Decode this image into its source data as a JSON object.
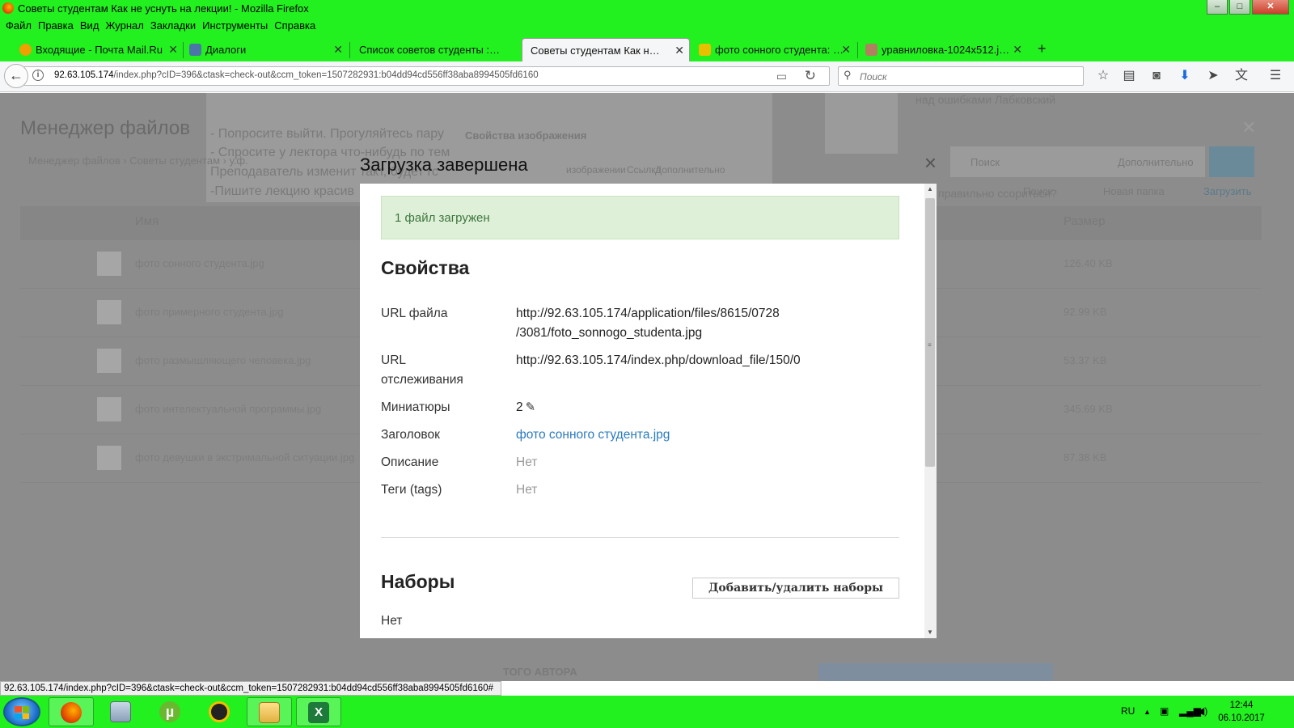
{
  "window": {
    "title": "Советы студентам Как не уснуть на лекции! - Mozilla Firefox",
    "controls": [
      "–",
      "□",
      "✕"
    ]
  },
  "menu": [
    "Файл",
    "Правка",
    "Вид",
    "Журнал",
    "Закладки",
    "Инструменты",
    "Справка"
  ],
  "tabs": [
    {
      "label": "Входящие - Почта Mail.Ru",
      "icon_color": "#f0a000"
    },
    {
      "label": "Диалоги",
      "icon_color": "#4a76a8"
    },
    {
      "label": "Список советов студенты :: со...",
      "icon_color": ""
    },
    {
      "label": "Советы студентам Как не усн...",
      "icon_color": ""
    },
    {
      "label": "фото сонного студента: 1...",
      "icon_color": "#e8c000"
    },
    {
      "label": "уравниловка-1024x512.jpg...",
      "icon_color": "#b08060"
    }
  ],
  "tab_close": "✕",
  "new_tab": "+",
  "address": {
    "host": "92.63.105.174",
    "path": "/index.php?cID=396&ctask=check-out&ccm_token=1507282931:b04dd94cd556ff38aba8994505fd6160"
  },
  "search": {
    "placeholder": "Поиск"
  },
  "toolbar_icons": [
    "star-icon",
    "reading-list-icon",
    "pocket-icon",
    "download-icon",
    "send-icon",
    "translate-icon",
    "menu-icon"
  ],
  "background": {
    "heading": "Менеджер файлов",
    "breadcrumb": "Менеджер файлов  ›  Советы студентам  ›  у.ф.",
    "article_lines": [
      "- Попросите выйти. Прогуляйтесь пару",
      "- Спросите у лектора что-нибудь по тем",
      "Преподаватель изменит такт, будет гс",
      "-Пишите лекцию красив"
    ],
    "inner_dialog_title": "Свойства изображения",
    "inner_tabs": [
      "изображении",
      "Ссылка",
      "Дополнительно"
    ],
    "right_text": "над ошибками Лабковский",
    "right_text_2": "правильно ссориться?",
    "search_ph": "Поиск",
    "search_extra": "Дополнительно",
    "actions": [
      "Поиск",
      "Новая папка",
      "Загрузить"
    ],
    "col_name": "Имя",
    "col_size": "Размер",
    "files": [
      {
        "name": "фото сонного студента.jpg",
        "size": "126.40 KB"
      },
      {
        "name": "фото примерного студента.jpg",
        "size": "92.99 KB"
      },
      {
        "name": "фото размышляющего человека.jpg",
        "size": "53.37 KB"
      },
      {
        "name": "фото интелектуальной программы.jpg",
        "size": "345.69 KB"
      },
      {
        "name": "фото девушки в экстримальной ситуации.jpg",
        "size": "87.38 KB"
      }
    ],
    "bottom_text": "ТОГО АВТОРА"
  },
  "modal": {
    "title": "Загрузка завершена",
    "close": "×",
    "alert": "1 файл загружен",
    "properties_heading": "Свойства",
    "props": {
      "url_label": "URL файла",
      "url_value_1": "http://92.63.105.174/application/files/8615/0728",
      "url_value_2": "/3081/foto_sonnogo_studenta.jpg",
      "track_label_1": "URL",
      "track_label_2": "отслеживания",
      "track_value": "http://92.63.105.174/index.php/download_file/150/0",
      "thumbs_label": "Миниатюры",
      "thumbs_value": "2",
      "title_label": "Заголовок",
      "title_value": "фото сонного студента.jpg",
      "desc_label": "Описание",
      "desc_value": "Нет",
      "tags_label": "Теги (tags)",
      "tags_value": "Нет"
    },
    "sets_heading": "Наборы",
    "sets_button": "Добавить/удалить наборы",
    "sets_value": "Нет"
  },
  "status_url": "92.63.105.174/index.php?cID=396&ctask=check-out&ccm_token=1507282931:b04dd94cd556ff38aba8994505fd6160#",
  "taskbar": {
    "apps": [
      "firefox",
      "calculator",
      "utorrent",
      "aimp",
      "explorer",
      "excel"
    ],
    "lang": "RU",
    "time": "12:44",
    "date": "06.10.2017"
  }
}
